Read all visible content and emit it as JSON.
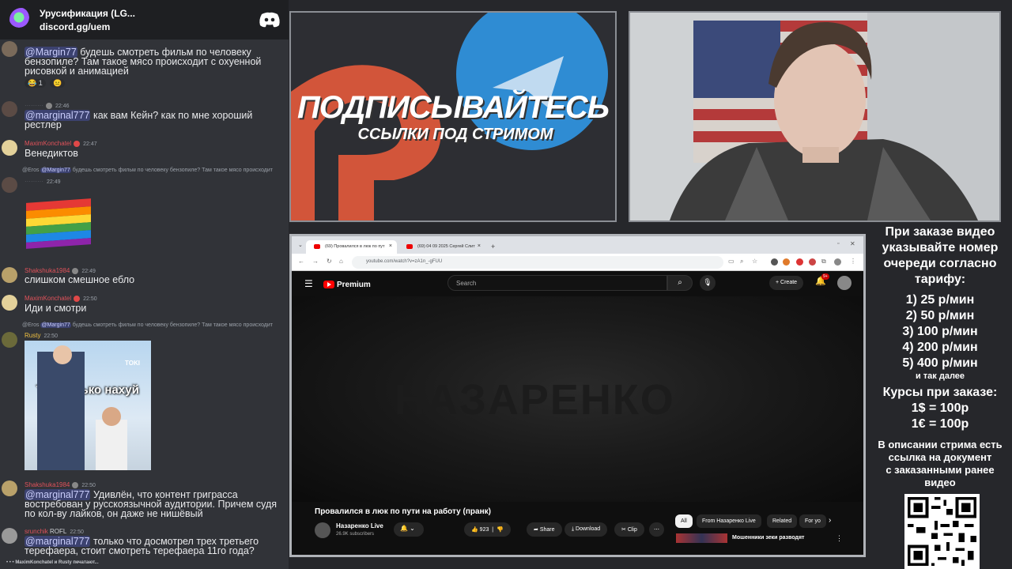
{
  "server": {
    "name": "Урусификация (LG...",
    "invite": "discord.gg/uem",
    "icon": "discord-icon"
  },
  "messages": [
    {
      "id": "m1",
      "text": "будешь смотреть фильм по человеку бензопиле? Там такое мясо происходит с охуенной рисовкой и анимацией",
      "mention": "@Margin77",
      "reactions": [
        "1"
      ]
    },
    {
      "id": "m2",
      "time": "22:46",
      "mention": "@marginal777",
      "text": " как вам Кейн? как по мне хороший рестлер"
    },
    {
      "id": "m3",
      "author": "MaximKonchatel",
      "time": "22:47",
      "text": "Венедиктов"
    },
    {
      "id": "m4",
      "reply_author": "@Eros",
      "reply_mention": "@Margin77",
      "reply_text": "будешь смотреть фильм по человеку бензопиле? Там такое мясо происходит",
      "time": "22:49"
    },
    {
      "id": "m5",
      "author": "Shakshuka1984",
      "time": "22:49",
      "text": "слишком смешное ебло"
    },
    {
      "id": "m6",
      "author": "MaximKonchatel",
      "time": "22:50",
      "text": "Иди и смотри"
    },
    {
      "id": "m7",
      "reply_author": "@Eros",
      "reply_mention": "@Margin77",
      "reply_text": "будешь смотреть фильм по человеку бензопиле? Там такое мясо происходит",
      "author": "Rusty",
      "time": "22:50",
      "gif_caption": "Тихосінько нахуй",
      "gif_logo": "TOKI"
    },
    {
      "id": "m8",
      "author": "Shakshuka1984",
      "time": "22:50",
      "mention": "@marginal777",
      "text": " Удивлён, что контент григрасса востребован у русскоязычной аудитории. Причем судя по кол-ву лайков, он даже не нишёвый"
    },
    {
      "id": "m9",
      "author": "srunchik",
      "tag": "ROFL",
      "time": "22:50",
      "mention": "@marginal777",
      "text": " только что досмотрел трех третьего терефаера, стоит смотреть терефаера 11го года?"
    }
  ],
  "typing": "MaximKonchatel и Rusty печатают...",
  "banner": {
    "line1": "ПОДПИСЫВАЙТЕСЬ",
    "line2": "ССЫЛКИ ПОД СТРИМОМ"
  },
  "browser": {
    "tab1": "(69) Провалился в люк по пут",
    "tab2": "(69) 04 09 2025 Сергей Слит",
    "url": "youtube.com/watch?v=zA1n_-gFUU",
    "brand": "Premium",
    "search_placeholder": "Search",
    "create": "Create",
    "notif_count": "9+",
    "watermark": "НАЗАРЕНКО",
    "video_title": "Провалился в люк по пути на работу (пранк)",
    "channel": "Назаренко Live",
    "subs": "26.9K subscribers",
    "likes": "923",
    "share": "Share",
    "download": "Download",
    "clip": "Clip",
    "chips": [
      "All",
      "From Назаренко Live",
      "Related",
      "For yo"
    ],
    "rec_title": "Мошенники зеки разводят"
  },
  "info": {
    "intro": [
      "При заказе видео",
      "указывайте номер",
      "очереди согласно",
      "тарифу:"
    ],
    "rates": [
      "1) 25 р/мин",
      "2) 50 р/мин",
      "3) 100 р/мин",
      "4) 200 р/мин",
      "5) 400 р/мин"
    ],
    "etc": "и так далее",
    "courses_title": "Курсы при заказе:",
    "courses": [
      "1$ = 100р",
      "1€ = 100р"
    ],
    "doc": [
      "В описании стрима есть",
      "ссылка на документ",
      "с заказанными ранее",
      "видео"
    ]
  }
}
